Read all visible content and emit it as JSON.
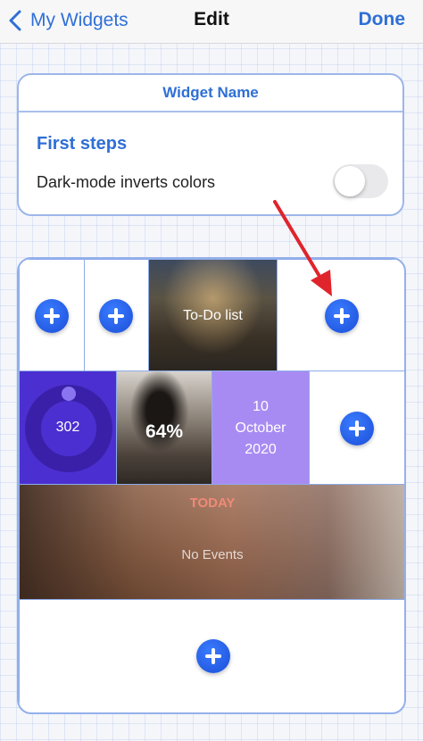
{
  "navbar": {
    "back_label": "My Widgets",
    "title": "Edit",
    "done_label": "Done"
  },
  "settings": {
    "widget_name_label": "Widget Name",
    "first_steps": "First steps",
    "dark_mode_label": "Dark-mode inverts colors",
    "dark_mode_on": false
  },
  "widgets": {
    "todo_label": "To-Do list",
    "counter_value": "302",
    "percent_value": "64%",
    "date_day": "10",
    "date_month": "October",
    "date_year": "2020",
    "calendar_title": "TODAY",
    "calendar_empty": "No Events"
  },
  "colors": {
    "accent": "#2f6fd6",
    "counter_bg": "#4b2fd0",
    "date_bg": "#a88bf2",
    "arrow": "#e0242b"
  },
  "icons": [
    "chevron-left-icon",
    "plus-icon",
    "arrow-icon"
  ]
}
